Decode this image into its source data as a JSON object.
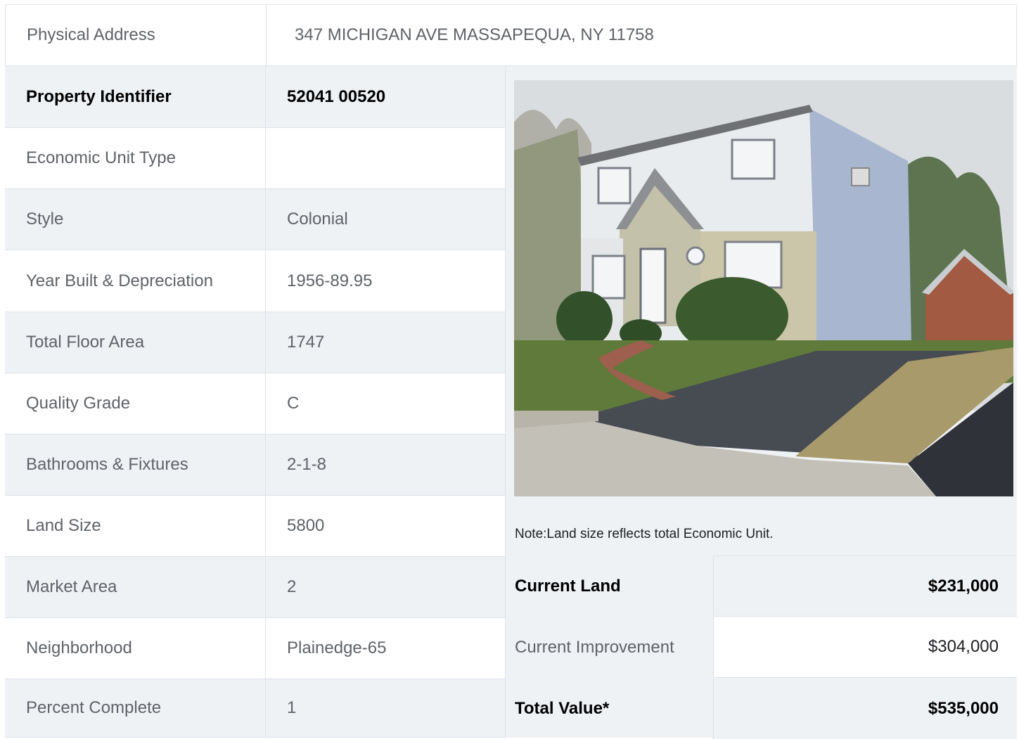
{
  "address": {
    "label": "Physical Address",
    "value": "347  MICHIGAN AVE  MASSAPEQUA, NY  11758"
  },
  "rows": [
    {
      "label": "Property Identifier",
      "value": "52041  00520"
    },
    {
      "label": "Economic Unit Type",
      "value": ""
    },
    {
      "label": "Style",
      "value": "Colonial"
    },
    {
      "label": "Year Built & Depreciation",
      "value": "1956-89.95"
    },
    {
      "label": "Total Floor Area",
      "value": "1747"
    },
    {
      "label": "Quality Grade",
      "value": "C"
    },
    {
      "label": "Bathrooms & Fixtures",
      "value": "2-1-8"
    },
    {
      "label": "Land Size",
      "value": "5800"
    },
    {
      "label": "Market Area",
      "value": "2"
    },
    {
      "label": "Neighborhood",
      "value": "Plainedge-65"
    },
    {
      "label": "Percent Complete",
      "value": "1"
    }
  ],
  "note": "Note:Land size reflects total Economic Unit.",
  "valuation": [
    {
      "label": "Current Land",
      "value": "$231,000"
    },
    {
      "label": "Current Improvement",
      "value": "$304,000"
    },
    {
      "label": "Total Value*",
      "value": "$535,000"
    }
  ]
}
